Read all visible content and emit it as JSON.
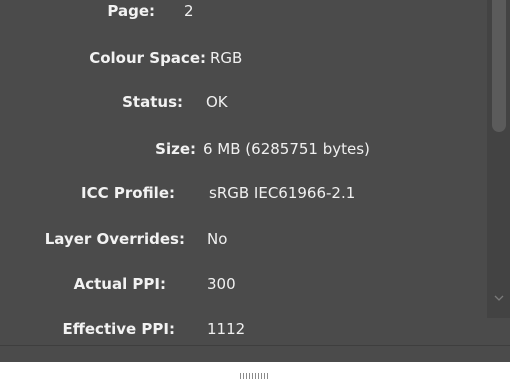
{
  "properties": [
    {
      "label": "Page:",
      "value": "2"
    },
    {
      "label": "Colour Space:",
      "value": "RGB"
    },
    {
      "label": "Status:",
      "value": "OK"
    },
    {
      "label": "Size:",
      "value": "6 MB (6285751 bytes)"
    },
    {
      "label": "ICC Profile:",
      "value": "sRGB IEC61966-2.1"
    },
    {
      "label": "Layer Overrides:",
      "value": "No"
    },
    {
      "label": "Actual PPI:",
      "value": "300"
    },
    {
      "label": "Effective PPI:",
      "value": "1112"
    }
  ],
  "scrollbar": {
    "down_icon": "chevron-down-icon",
    "position": 0
  },
  "colors": {
    "panel_bg": "#4b4b4b",
    "text": "#f0f0f0"
  }
}
